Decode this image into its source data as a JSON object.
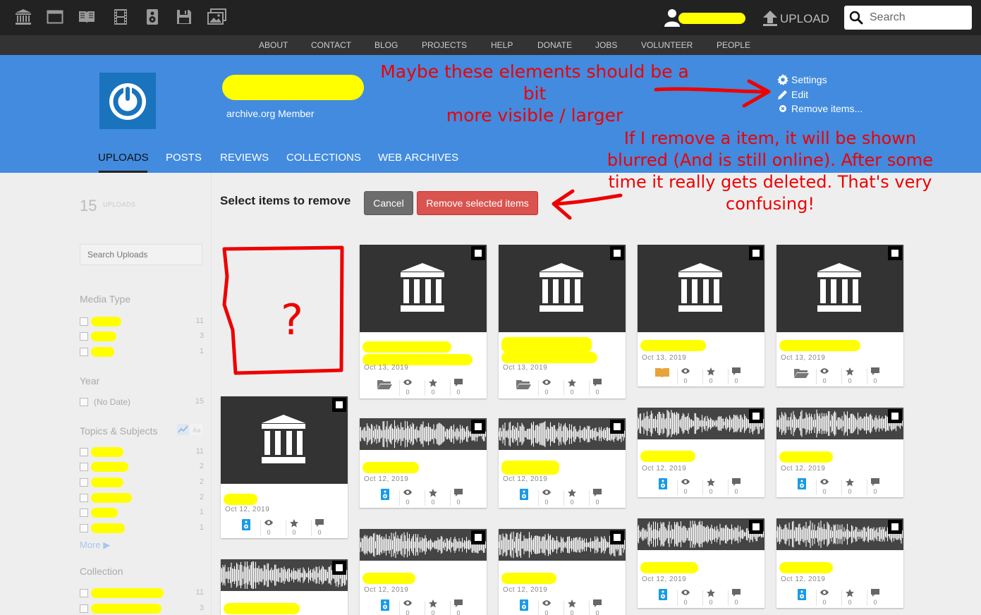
{
  "colors": {
    "topbar": "#222222",
    "navbar": "#333333",
    "hero": "#428bdf",
    "highlight": "#ffff00",
    "annotation": "#ee0000",
    "remove_button": "#d9534f",
    "cancel_button": "#6d6d6d"
  },
  "topbar": {
    "icons": [
      "archive-icon",
      "web-icon",
      "texts-icon",
      "video-icon",
      "audio-icon",
      "software-icon",
      "images-icon"
    ],
    "upload_label": "UPLOAD",
    "search_placeholder": "Search"
  },
  "nav": {
    "links": [
      "ABOUT",
      "CONTACT",
      "BLOG",
      "PROJECTS",
      "HELP",
      "DONATE",
      "JOBS",
      "VOLUNTEER",
      "PEOPLE"
    ]
  },
  "profile": {
    "subtitle": "archive.org Member",
    "actions": {
      "settings": "Settings",
      "edit": "Edit",
      "remove": "Remove items..."
    },
    "tabs": [
      "UPLOADS",
      "POSTS",
      "REVIEWS",
      "COLLECTIONS",
      "WEB ARCHIVES"
    ]
  },
  "annotations": {
    "note1": [
      "Maybe these elements should be a bit",
      "more visible / larger"
    ],
    "note2": [
      "If I remove a item, it will be shown",
      "blurred (And is still online). After some",
      "time it really gets deleted. That's very",
      "confusing!"
    ],
    "question": "?"
  },
  "sidebar": {
    "count": "15",
    "count_label": "UPLOADS",
    "search_placeholder": "Search Uploads",
    "media_type": {
      "title": "Media Type",
      "counts": [
        "11",
        "3",
        "1"
      ]
    },
    "year": {
      "title": "Year",
      "items": [
        {
          "label": "(No Date)",
          "count": "15"
        }
      ]
    },
    "topics": {
      "title": "Topics & Subjects",
      "counts": [
        "11",
        "2",
        "2",
        "2",
        "1",
        "1"
      ]
    },
    "more": "More",
    "collection": {
      "title": "Collection",
      "counts": [
        "11",
        "3"
      ]
    }
  },
  "remove_bar": {
    "title": "Select items to remove",
    "cancel": "Cancel",
    "remove": "Remove selected items"
  },
  "tiles": {
    "t1": {
      "date": "Oct 13, 2019",
      "type_icon": "folder-icon",
      "views": "0",
      "favs": "0",
      "reviews": "0"
    },
    "t2": {
      "date": "Oct 13, 2019",
      "type_icon": "folder-icon",
      "views": "0",
      "favs": "0",
      "reviews": "0"
    },
    "t3": {
      "date": "Oct 13, 2019",
      "type_icon": "book-icon",
      "views": "0",
      "favs": "0",
      "reviews": "0"
    },
    "t4": {
      "date": "Oct 13, 2019",
      "type_icon": "folder-icon",
      "views": "0",
      "favs": "0",
      "reviews": "0"
    },
    "t5": {
      "date": "Oct 12, 2019",
      "type_icon": "audio-icon",
      "views": "0",
      "favs": "0",
      "reviews": "0"
    },
    "t6": {
      "date": "Oct 12, 2019",
      "type_icon": "audio-icon",
      "views": "0",
      "favs": "0",
      "reviews": "0"
    },
    "t7": {
      "date": "Oct 12, 2019",
      "type_icon": "audio-icon",
      "views": "0",
      "favs": "0",
      "reviews": "0"
    },
    "t8": {
      "date": "Oct 12, 2019",
      "type_icon": "audio-icon",
      "views": "0",
      "favs": "0",
      "reviews": "0"
    },
    "t9": {
      "date": "Oct 12, 2019",
      "type_icon": "audio-icon",
      "views": "0",
      "favs": "0",
      "reviews": "0"
    },
    "t10": {
      "date": "Oct 12, 2019",
      "type_icon": "audio-icon",
      "views": "0",
      "favs": "0",
      "reviews": "0"
    },
    "t11": {
      "date": "Oct 12, 2019",
      "type_icon": "audio-icon",
      "views": "0",
      "favs": "0",
      "reviews": "0"
    },
    "t12": {
      "date": "Oct 12, 2019",
      "type_icon": "audio-icon",
      "views": "0",
      "favs": "0",
      "reviews": "0"
    },
    "t13": {
      "date": "Oct 12, 2019",
      "type_icon": "audio-icon",
      "views": "0",
      "favs": "0",
      "reviews": "0"
    }
  }
}
